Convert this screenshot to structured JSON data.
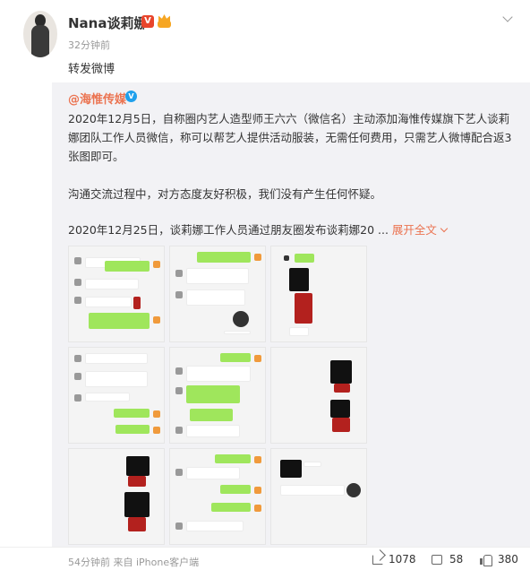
{
  "user": {
    "name": "Nana谈莉娜",
    "time": "32分钟前",
    "repost_text": "转发微博"
  },
  "original": {
    "author": "@海惟传媒",
    "para1": "2020年12月5日，自称圈内艺人造型师王六六（微信名）主动添加海惟传媒旗下艺人谈莉娜团队工作人员微信，称可以帮艺人提供活动服装，无需任何费用，只需艺人微博配合返3张图即可。",
    "para2": "沟通交流过程中，对方态度友好积极，我们没有产生任何怀疑。",
    "para3": "2020年12月25日，谈莉娜工作人员通过朋友圈发布谈莉娜20 ...",
    "expand": "展开全文"
  },
  "footer": {
    "source": "54分钟前 来自 iPhone客户端",
    "reposts": "1078",
    "comments": "58",
    "likes": "380"
  },
  "colors": {
    "accent": "#eb7350",
    "verified_blue": "#1fa0ec",
    "repost_bg": "#f2f2f5",
    "chat_green": "#9fe65c"
  },
  "icons": [
    "chevron-down-icon",
    "verified-v-icon",
    "member-crown-icon",
    "share-icon",
    "comment-icon",
    "like-icon"
  ]
}
